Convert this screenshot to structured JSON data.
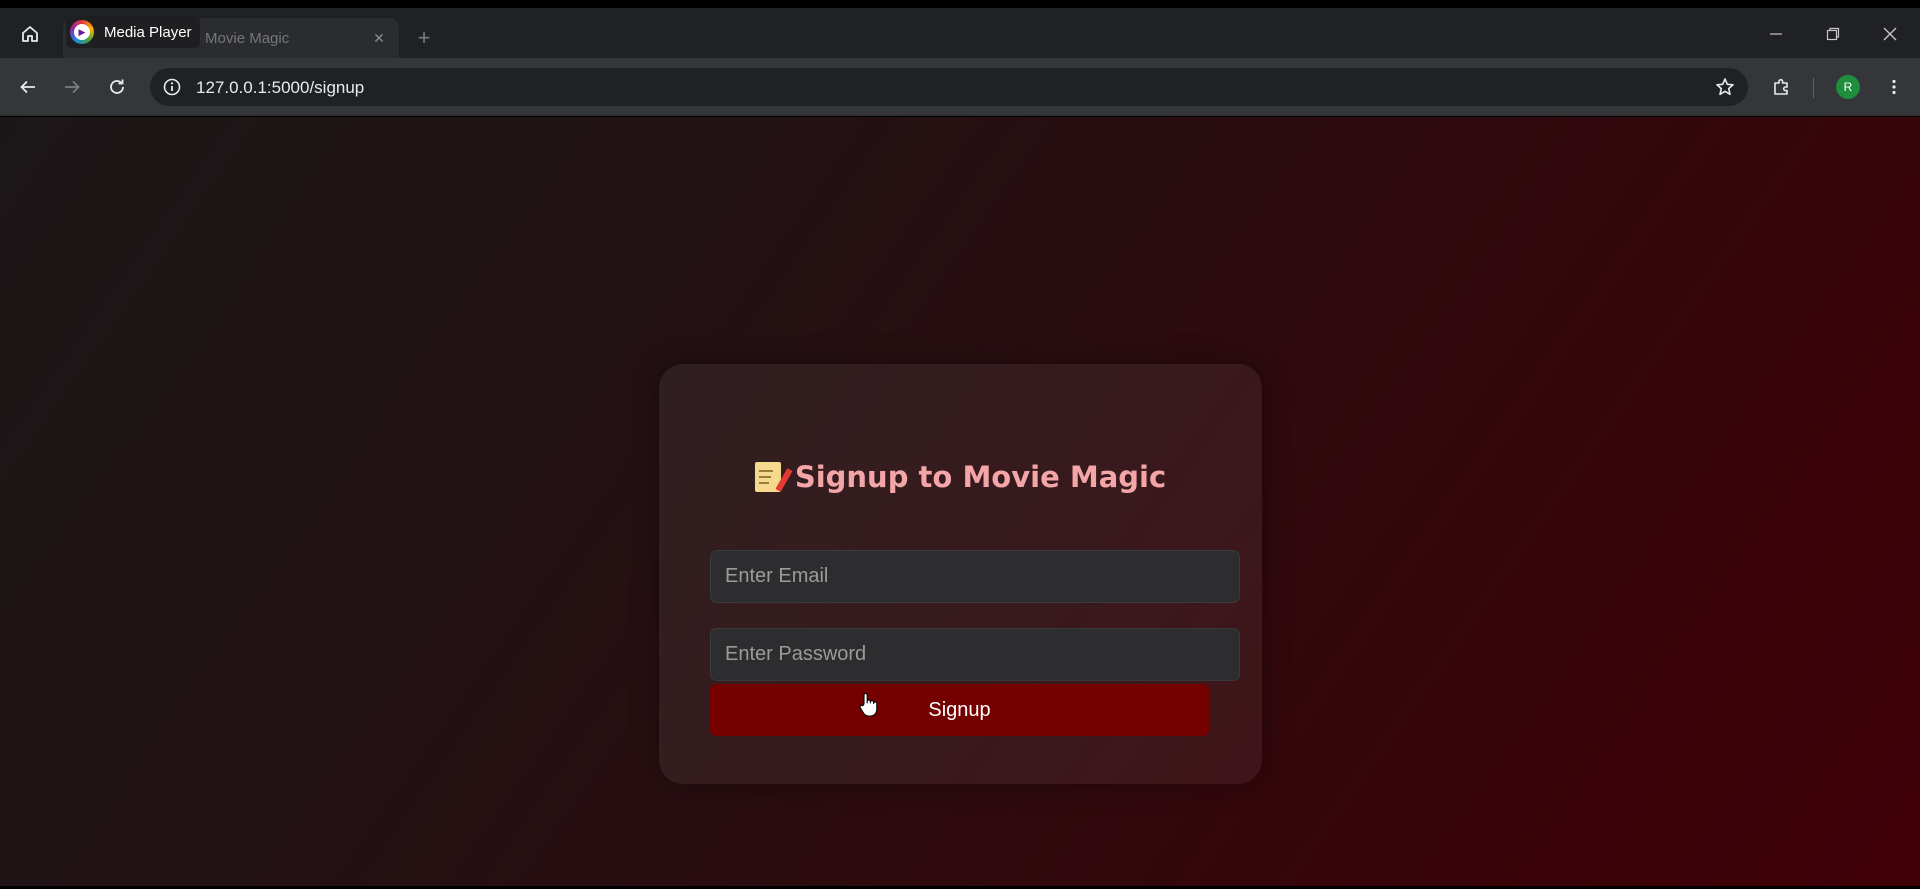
{
  "browser": {
    "window_label": "Media Player",
    "tab_title": "Signup - Movie Magic",
    "url": "127.0.0.1:5000/signup",
    "avatar_letter": "R",
    "icons": [
      "home-icon",
      "back-icon",
      "forward-icon",
      "reload-icon",
      "info-icon",
      "star-icon",
      "extensions-icon",
      "menu-icon",
      "minimize-icon",
      "restore-icon",
      "close-icon"
    ]
  },
  "signup": {
    "title": "Signup to Movie Magic",
    "title_icon": "memo-icon",
    "email_placeholder": "Enter Email",
    "password_placeholder": "Enter Password",
    "button_label": "Signup"
  },
  "colors": {
    "title": "#f3a5a7",
    "button": "#750000",
    "field": "#2d2d2f",
    "background_start": "#1b1718",
    "background_end": "#400008"
  }
}
